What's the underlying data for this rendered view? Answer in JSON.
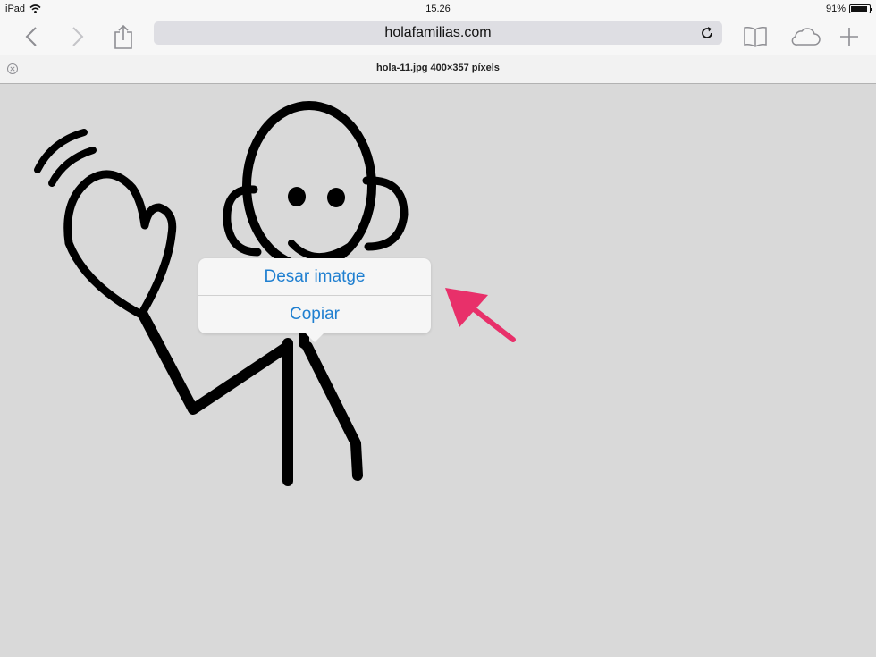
{
  "status_bar": {
    "device": "iPad",
    "time": "15.26",
    "battery": "91%",
    "battery_level": 0.91
  },
  "toolbar": {
    "url": "holafamilias.com"
  },
  "page": {
    "title": "hola-11.jpg 400×357 píxels"
  },
  "context_menu": {
    "items": [
      {
        "label": "Desar imatge"
      },
      {
        "label": "Copiar"
      }
    ]
  },
  "colors": {
    "accent": "#1f7fd0",
    "annotation_arrow": "#e8306a"
  }
}
